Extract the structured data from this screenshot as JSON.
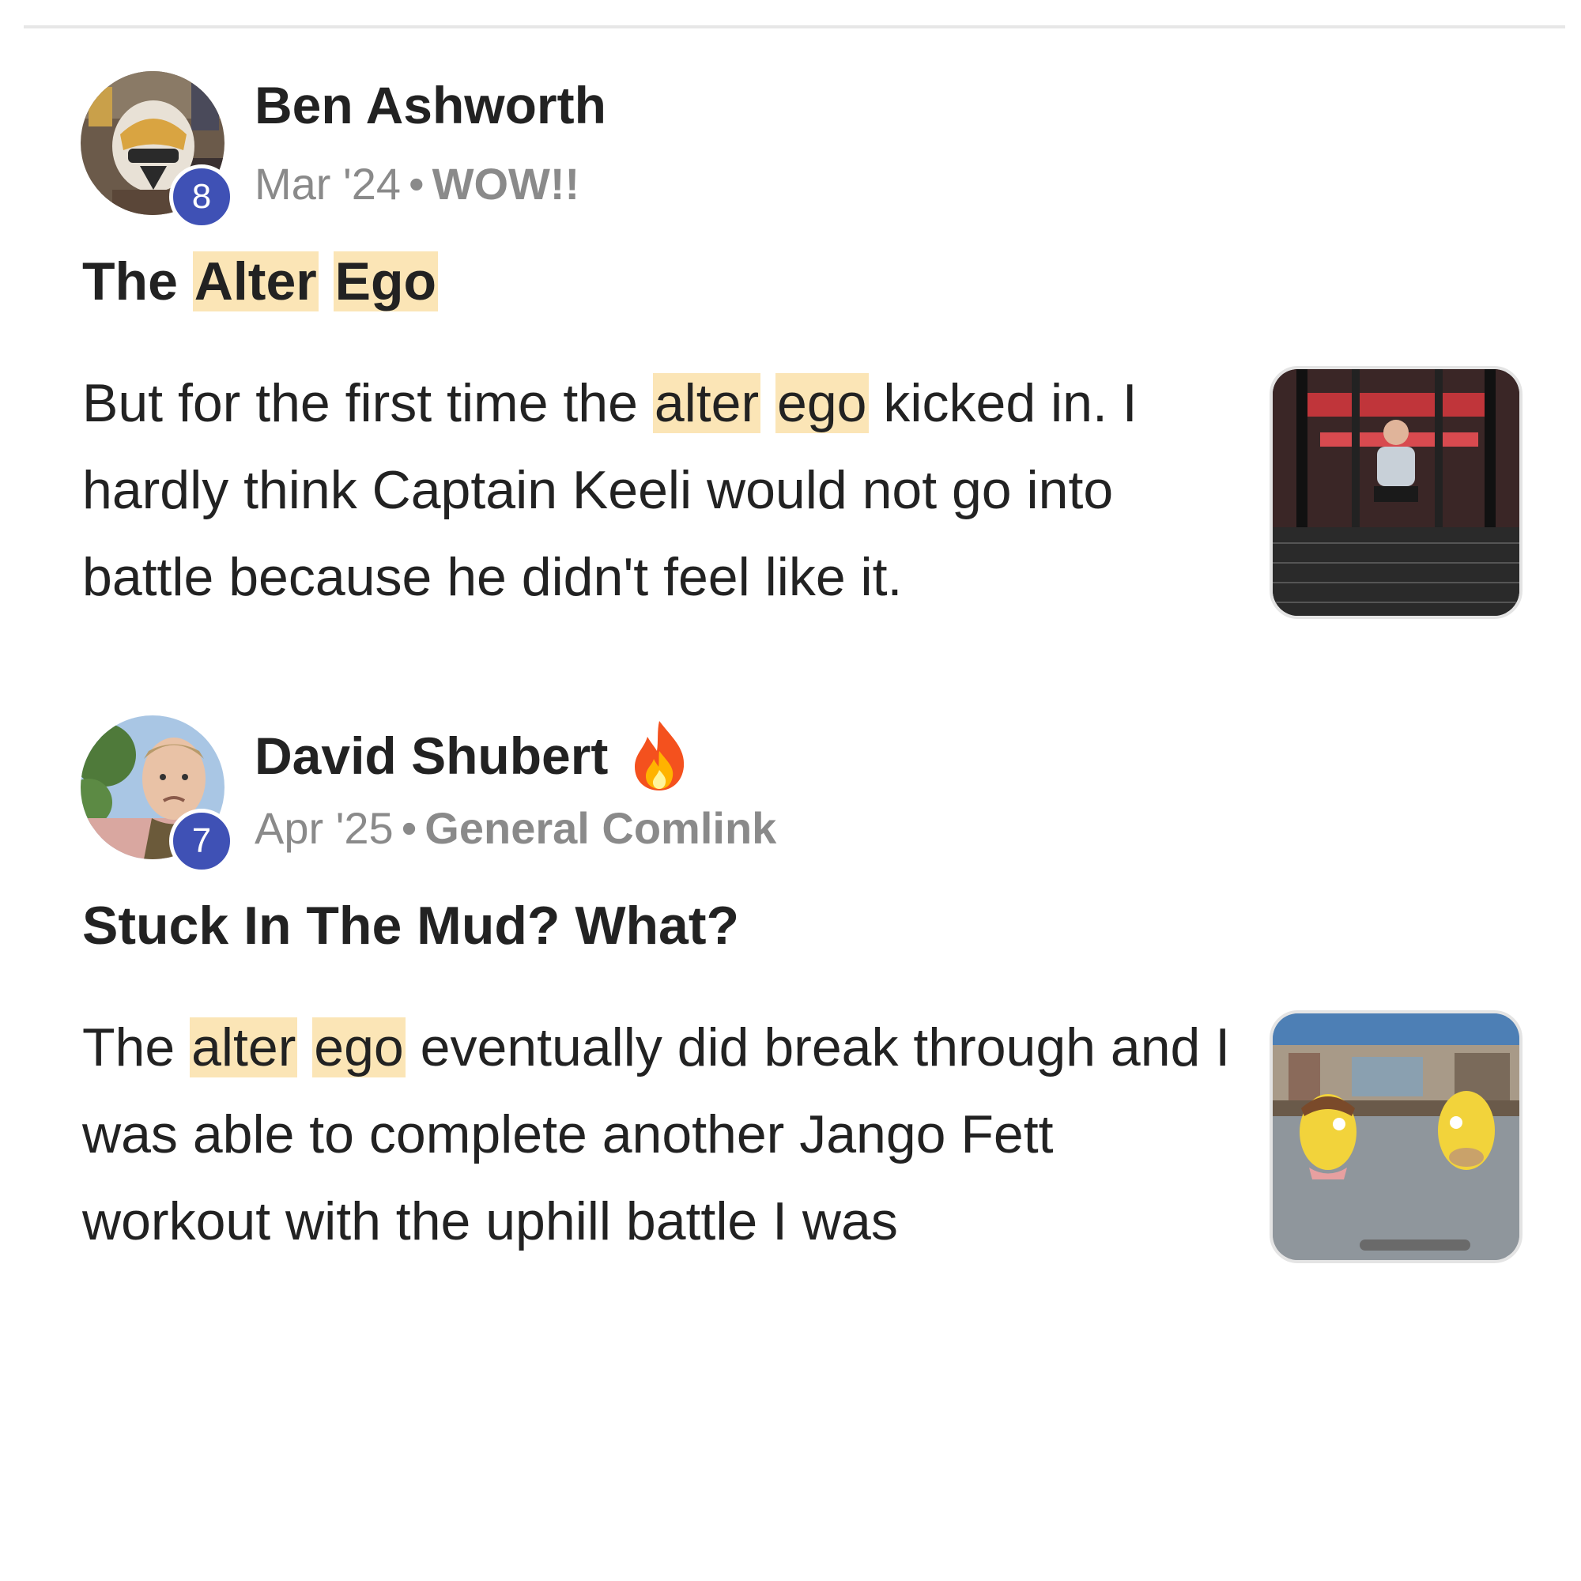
{
  "posts": [
    {
      "author": "Ben Ashworth",
      "level": "8",
      "date": "Mar '24",
      "separator": "•",
      "category": "WOW!!",
      "title_parts": [
        "The ",
        "Alter",
        " ",
        "Ego"
      ],
      "excerpt_parts": [
        "But for the first time the ",
        "alter",
        " ",
        "ego",
        " kicked in. I hardly think Captain Keeli would not go into battle because he didn't feel like it."
      ],
      "avatar_icon": "clone-trooper-helmet-avatar",
      "thumbnail_icon": "gym-mirror-selfie-thumbnail"
    },
    {
      "author": "David Shubert",
      "author_emoji_icon": "flame-icon",
      "level": "7",
      "date": "Apr '25",
      "separator": "•",
      "category": "General Comlink",
      "title": "Stuck In The Mud? What?",
      "excerpt_parts": [
        "The ",
        "alter",
        " ",
        "ego",
        " eventually did break through and I was able to complete another Jango Fett workout with the uphill battle I was"
      ],
      "avatar_icon": "man-portrait-avatar",
      "thumbnail_icon": "cartoon-characters-thumbnail"
    }
  ],
  "colors": {
    "highlight": "#fbe5b6",
    "level_badge": "#3f51b5",
    "meta_text": "#8a8a8a",
    "body_text": "#222222"
  }
}
